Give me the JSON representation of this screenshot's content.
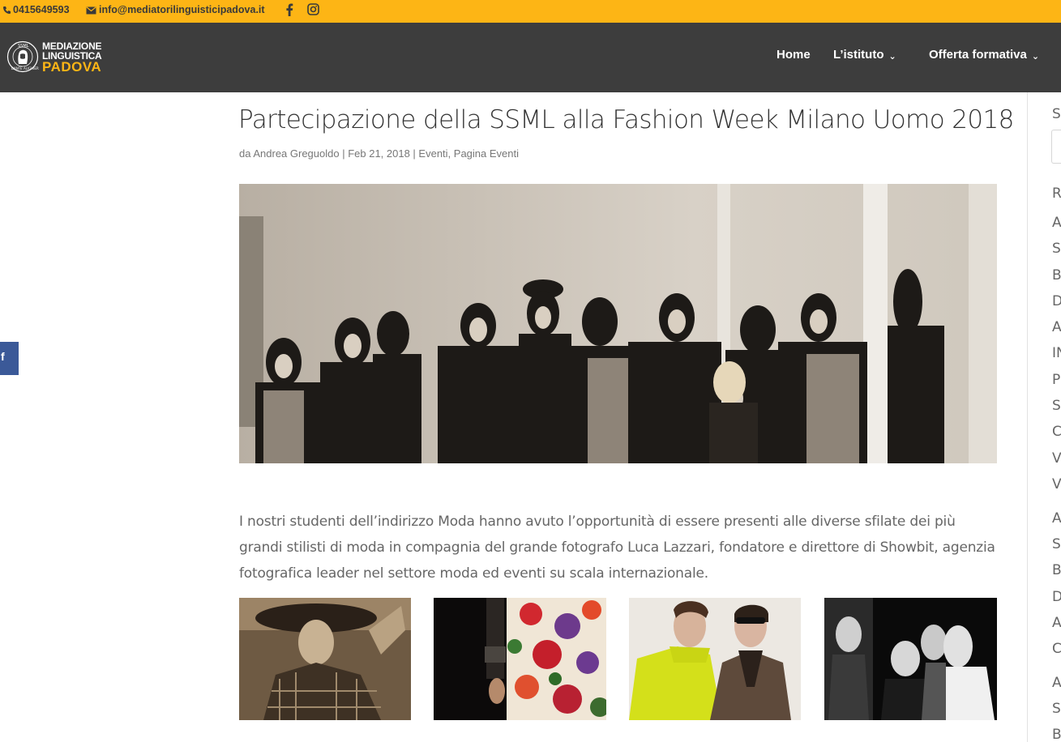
{
  "topbar": {
    "phone": "0415649593",
    "email": "info@mediatorilinguisticipadova.it",
    "phone_icon": "phone-icon",
    "email_icon": "envelope-icon",
    "social_icons": [
      "facebook-icon",
      "instagram-icon"
    ]
  },
  "logo": {
    "line1": "MEDIAZIONE",
    "line2": "LINGUISTICA",
    "line3": "PADOVA",
    "seal_text": "SSML DANTE ALIGHIERI"
  },
  "nav": {
    "items": [
      {
        "label": "Home",
        "has_dropdown": false
      },
      {
        "label": "L’istituto",
        "has_dropdown": true
      },
      {
        "label": "Offerta formativa",
        "has_dropdown": true
      }
    ]
  },
  "article": {
    "title": "Partecipazione della SSML alla Fashion Week Milano Uomo 2018",
    "meta": "da Andrea Greguoldo | Feb 21, 2018 | Eventi, Pagina Eventi",
    "paragraph": "I nostri studenti dell’indirizzo Moda hanno avuto l’opportunità di essere presenti alle diverse sfilate dei più grandi stilisti di moda in compagnia del grande fotografo Luca Lazzari, fondatore e direttore di Showbit, agenzia fotografica leader nel settore moda ed eventi su scala internazionale."
  },
  "sidebar": {
    "letters": [
      "S",
      "R",
      "A",
      "S",
      "B",
      "D",
      "A",
      "IN",
      "P",
      "S",
      "C",
      "V",
      "V",
      "A",
      "S",
      "B",
      "D",
      "A",
      "C",
      "A",
      "S",
      "B"
    ]
  },
  "share": {
    "icon": "facebook-share-icon"
  },
  "colors": {
    "accent": "#fdb515",
    "header_bg": "#3d3d3d",
    "facebook": "#3b5998"
  }
}
